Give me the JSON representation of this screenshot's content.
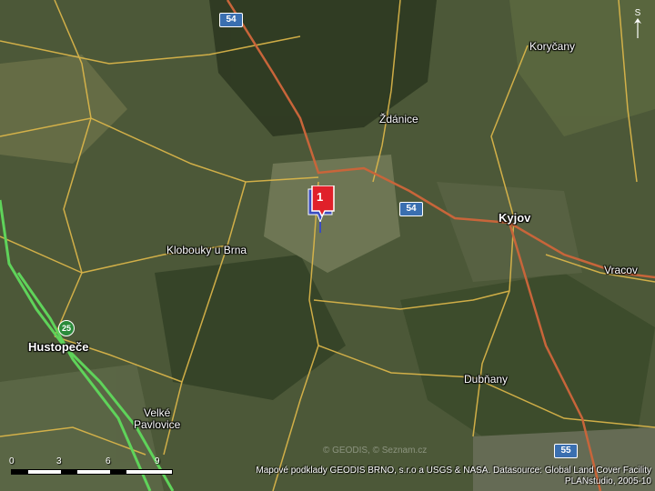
{
  "map": {
    "places": [
      {
        "name": "Koryčany",
        "bold": false
      },
      {
        "name": "Ždánice",
        "bold": false
      },
      {
        "name": "Kyjov",
        "bold": true
      },
      {
        "name": "Klobouky u Brna",
        "bold": false
      },
      {
        "name": "Hustopeče",
        "bold": true
      },
      {
        "name": "Vracov",
        "bold": false
      },
      {
        "name": "Dubňany",
        "bold": false
      },
      {
        "name": "Velké\nPavlovice",
        "bold": false
      }
    ],
    "road_shields": [
      "54",
      "54",
      "55"
    ],
    "motorway_shield": "25",
    "marker_label": "1",
    "north_symbol": "S",
    "scale_ticks": [
      "0",
      "3",
      "6",
      "9"
    ],
    "attribution_line1": "Mapové podklady GEODIS BRNO, s.r.o a USGS & NASA. Datasource: Global Land Cover Facility",
    "attribution_line2": "PLANstudio, 2005-10",
    "watermark": "© GEODIS, © Seznam.cz",
    "colors": {
      "terrain": "#4a5636",
      "forest": "#2f3a22",
      "road_minor": "#e0b94a",
      "road_primary": "#c8653a",
      "motorway": "#5fd35a",
      "shield_blue": "#3a6fb0",
      "marker_red": "#e0202a"
    }
  }
}
